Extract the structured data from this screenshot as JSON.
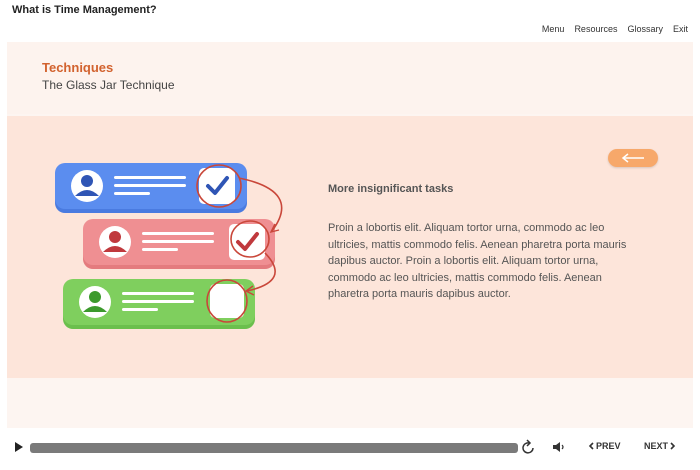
{
  "app": {
    "title": "What is Time Management?"
  },
  "top_menu": {
    "items": [
      "Menu",
      "Resources",
      "Glossary",
      "Exit"
    ]
  },
  "slide": {
    "section_title": "Techniques",
    "subtitle": "The Glass Jar Technique",
    "heading": "More insignificant tasks",
    "body": "Proin a lobortis elit. Aliquam tortor urna, commodo ac leo ultricies, mattis commodo felis. Aenean pharetra porta mauris dapibus auctor. Proin a lobortis elit. Aliquam tortor urna, commodo ac leo ultricies, mattis commodo felis. Aenean pharetra porta mauris dapibus auctor."
  },
  "illustration": {
    "cards": [
      {
        "color": "#5b8def",
        "status": "checked",
        "check_color": "#2f55b5"
      },
      {
        "color": "#ef8f92",
        "status": "checked",
        "check_color": "#c0393d"
      },
      {
        "color": "#7fcf5e",
        "status": "unchecked",
        "check_color": "#3c9a2d"
      }
    ],
    "icons": [
      "user-icon",
      "checkmark-icon",
      "empty-checkbox-icon"
    ]
  },
  "player": {
    "progress": 0,
    "prev_label": "PREV",
    "next_label": "NEXT",
    "icons": [
      "play-icon",
      "replay-icon",
      "volume-icon",
      "chevron-left-icon",
      "chevron-right-icon",
      "arrow-left-icon"
    ]
  },
  "colors": {
    "accent": "#d2622e",
    "slide_background": "#fde5da",
    "back_button": "#f7a86a"
  }
}
